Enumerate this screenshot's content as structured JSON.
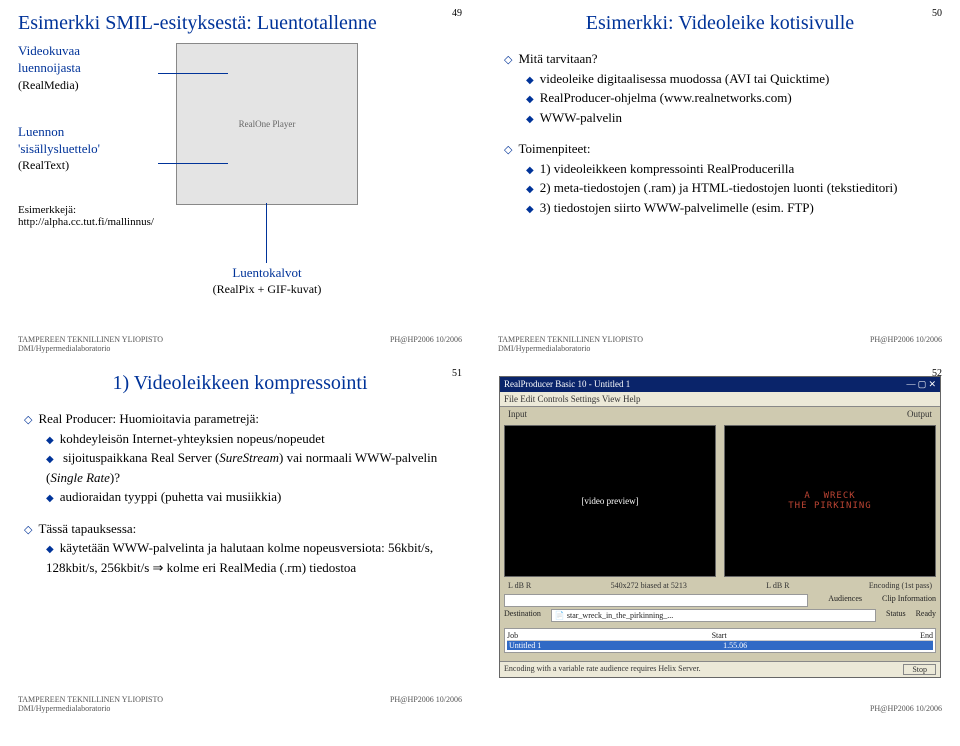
{
  "s49": {
    "num": "49",
    "title": "Esimerkki SMIL-esityksestä: Luentotallenne",
    "lbl1a": "Videokuvaa",
    "lbl1b": "luennoijasta",
    "lbl1c": "(RealMedia)",
    "lbl2a": "Luennon",
    "lbl2b": "'sisällysluettelo'",
    "lbl2c": "(RealText)",
    "ex": "Esimerkkejä:",
    "url": "http://alpha.cc.tut.fi/mallinnus/",
    "cal_a": "Luentokalvot",
    "cal_b": "(RealPix + GIF-kuvat)",
    "foot1": "TAMPEREEN TEKNILLINEN YLIOPISTO",
    "foot2": "DMI/Hypermedialaboratorio",
    "foot3": "PH@HP2006 10/2006"
  },
  "s50": {
    "num": "50",
    "title": "Esimerkki: Videoleike kotisivulle",
    "b1": "Mitä tarvitaan?",
    "b1a": "videoleike digitaalisessa muodossa (AVI tai Quicktime)",
    "b1b": "RealProducer-ohjelma (www.realnetworks.com)",
    "b1c": "WWW-palvelin",
    "b2": "Toimenpiteet:",
    "b2a": "1) videoleikkeen kompressointi RealProducerilla",
    "b2b": "2) meta-tiedostojen (.ram) ja HTML-tiedostojen luonti (tekstieditori)",
    "b2c": "3) tiedostojen siirto WWW-palvelimelle (esim. FTP)",
    "foot1": "TAMPEREEN TEKNILLINEN YLIOPISTO",
    "foot2": "DMI/Hypermedialaboratorio",
    "foot3": "PH@HP2006 10/2006"
  },
  "s51": {
    "num": "51",
    "title": "1) Videoleikkeen kompressointi",
    "b1": "Real Producer: Huomioitavia parametrejä:",
    "b1a": "kohdeyleisön Internet-yhteyksien nopeus/nopeudet",
    "b1b1": "sijoituspaikkana Real Server (",
    "b1b2": "SureStream",
    "b1b3": ") vai normaali WWW-palvelin (",
    "b1b4": "Single Rate",
    "b1b5": ")?",
    "b1c": "audioraidan tyyppi (puhetta vai musiikkia)",
    "b2": "Tässä tapauksessa:",
    "b2a": "käytetään WWW-palvelinta ja halutaan kolme nopeusversiota: 56kbit/s, 128kbit/s, 256kbit/s ⇒ kolme eri RealMedia (.rm) tiedostoa",
    "foot1": "TAMPEREEN TEKNILLINEN YLIOPISTO",
    "foot2": "DMI/Hypermedialaboratorio",
    "foot3": "PH@HP2006 10/2006"
  },
  "s52": {
    "num": "52",
    "app_title": "RealProducer Basic 10 - Untitled 1",
    "app_menu": "File  Edit  Controls  Settings  View  Help",
    "lab_in": "Input",
    "lab_out": "Output",
    "vid_in": "[video preview]",
    "vid_out": "A  WRECK\nTHE PIRKINING",
    "res": "540x272 biased at 5213",
    "enc": "Encoding (1st pass)",
    "sec_aud": "Audiences",
    "sec_clip": "Clip Information",
    "sec_dest": "Destination",
    "sec_stat": "Status",
    "dest_file": "star_wreck_in_the_pirkinning_...",
    "dest_ready": "Ready",
    "job_h1": "Job",
    "job_h2": "Start",
    "job_h3": "End",
    "job_name": "Untitled 1",
    "job_time": "1.55.06",
    "status_l": "Encoding with a variable rate audience requires Helix Server.",
    "status_r": "Stop",
    "foot3": "PH@HP2006 10/2006"
  }
}
